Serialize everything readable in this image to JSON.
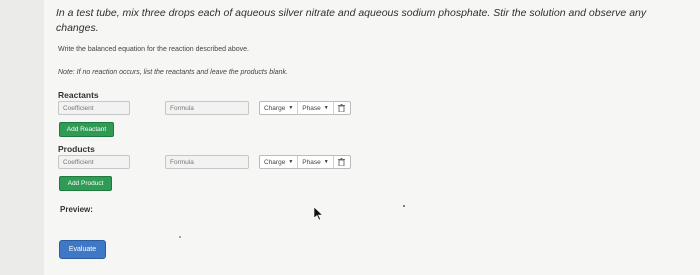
{
  "question": "In a test tube, mix three drops each of aqueous silver nitrate and aqueous sodium phosphate. Stir the solution and observe any changes.",
  "instruction": "Write the balanced equation for the reaction described above.",
  "note": "Note: If no reaction occurs, list the reactants and leave the products blank.",
  "reactants": {
    "label": "Reactants",
    "coefficient_placeholder": "Coefficient",
    "formula_placeholder": "Formula",
    "charge_label": "Charge",
    "phase_label": "Phase",
    "add_button": "Add Reactant"
  },
  "products": {
    "label": "Products",
    "coefficient_placeholder": "Coefficient",
    "formula_placeholder": "Formula",
    "charge_label": "Charge",
    "phase_label": "Phase",
    "add_button": "Add Product"
  },
  "preview_label": "Preview:",
  "evaluate_button": "Evaluate",
  "colors": {
    "green_button": "#2f9b55",
    "blue_button": "#3f78c4",
    "background": "#ebebea"
  },
  "icons": [
    "trash-icon",
    "chevron-down-icon",
    "mouse-cursor-icon"
  ]
}
